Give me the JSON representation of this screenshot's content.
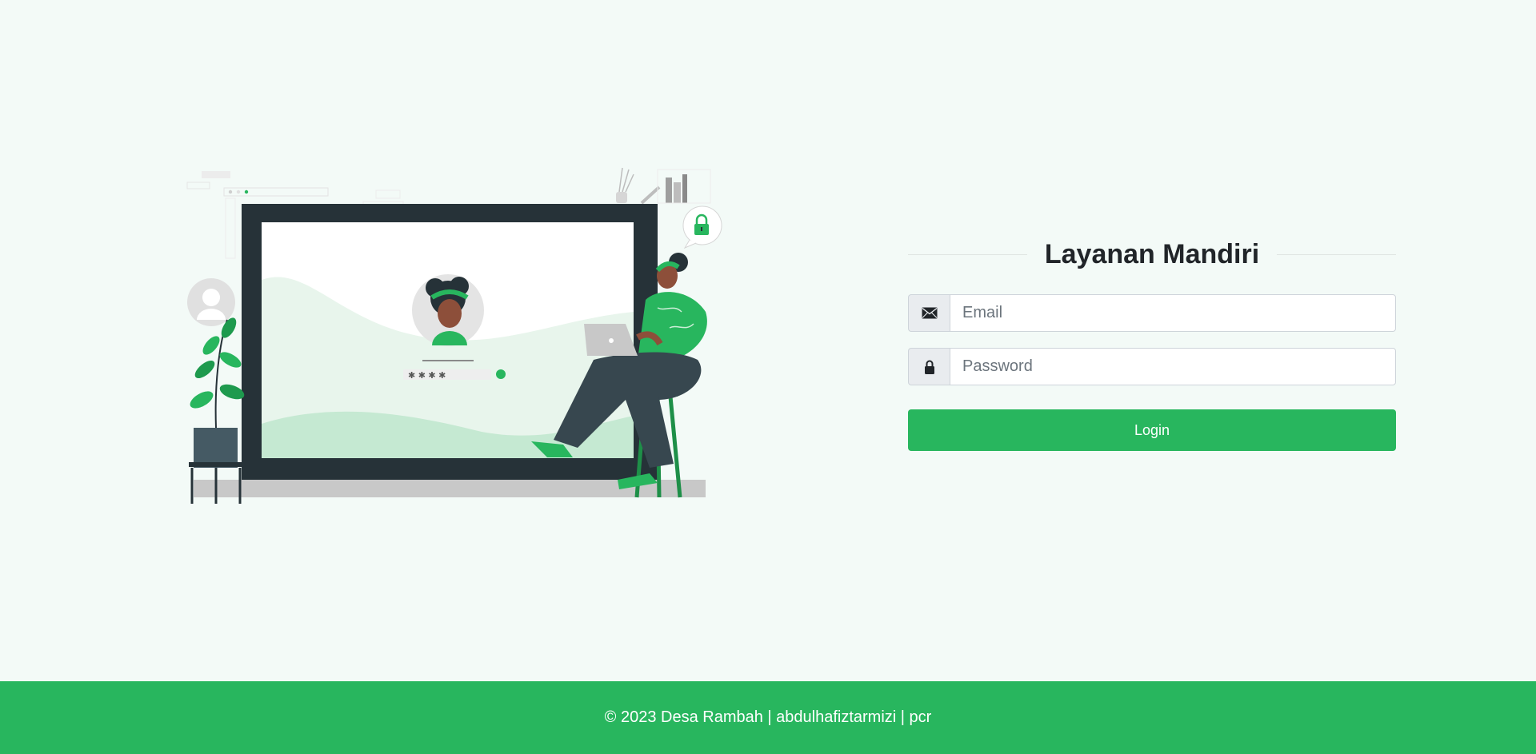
{
  "login": {
    "title": "Layanan Mandiri",
    "email_placeholder": "Email",
    "password_placeholder": "Password",
    "button_label": "Login",
    "email_icon": "envelope-icon",
    "password_icon": "lock-icon"
  },
  "footer": {
    "text": "© 2023 Desa Rambah | abdulhafiztarmizi | pcr"
  },
  "colors": {
    "accent": "#28b65e",
    "background": "#f3faf7",
    "dark": "#263238"
  }
}
